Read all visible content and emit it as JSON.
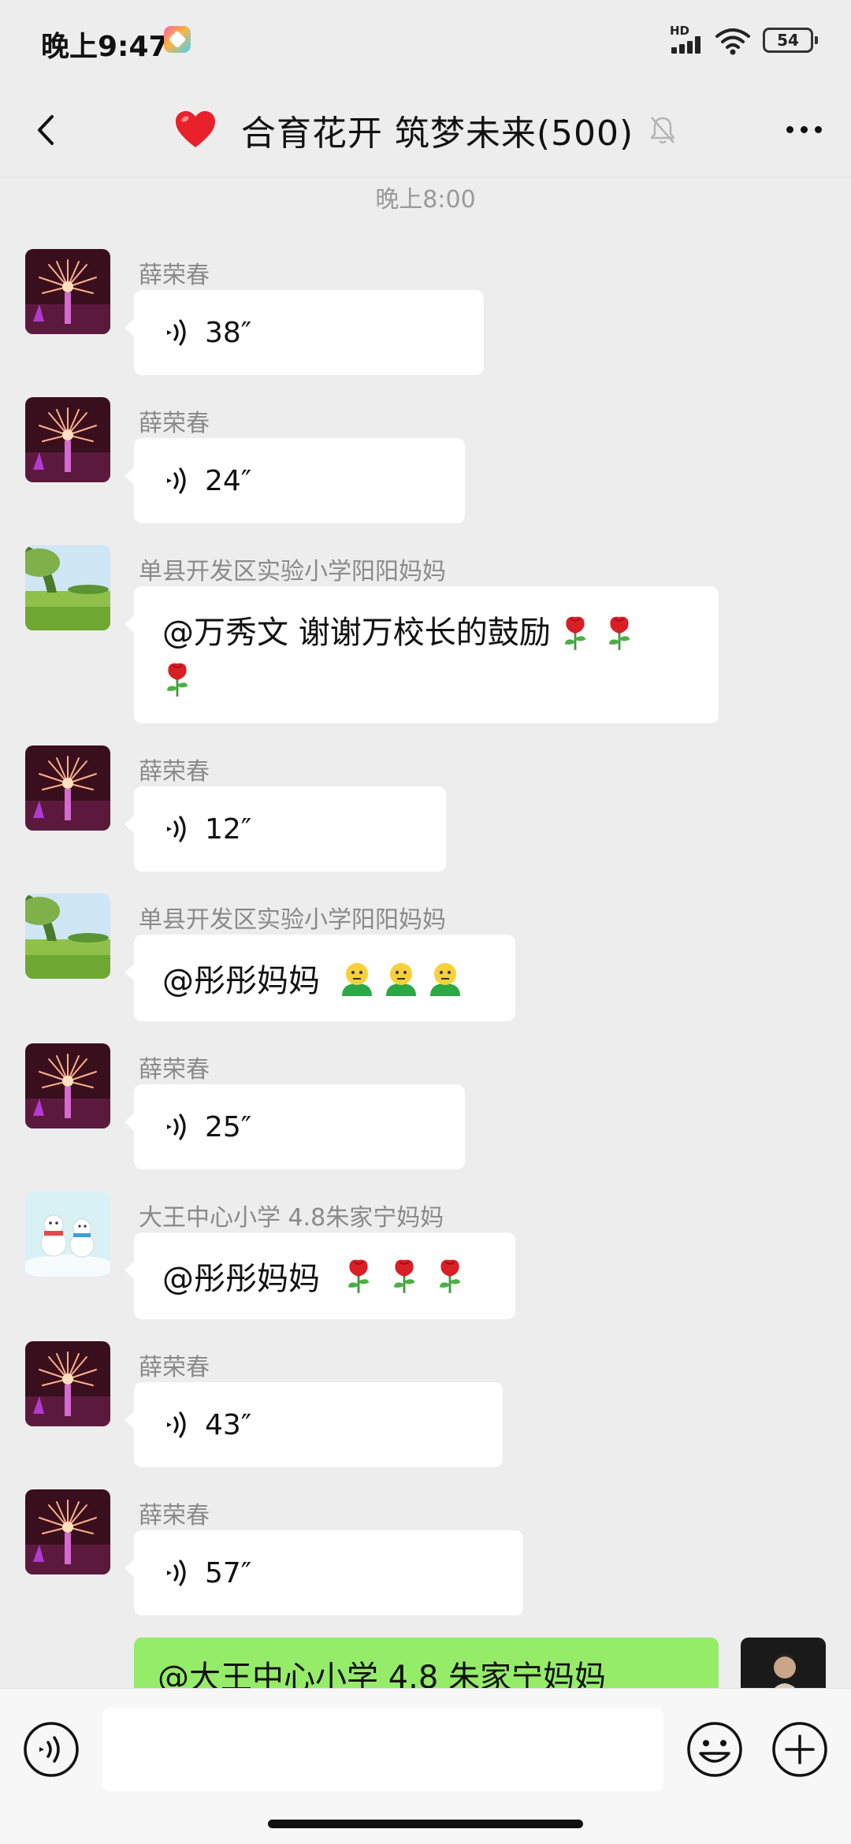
{
  "status_bar": {
    "time": "晚上9:47",
    "network_label": "HD",
    "battery": "54",
    "icons": [
      "app-badge-icon",
      "signal-icon",
      "wifi-icon",
      "battery-icon"
    ]
  },
  "header": {
    "title": "合育花开 筑梦未来(500)",
    "title_emoji": "heart",
    "icons": [
      "back-icon",
      "heart-icon",
      "mute-bell-icon",
      "more-icon"
    ]
  },
  "chat": {
    "timestamp": "晚上8:00",
    "messages": [
      {
        "sender": "薛荣春",
        "type": "voice",
        "duration": "38″",
        "avatar": "fireworks"
      },
      {
        "sender": "薛荣春",
        "type": "voice",
        "duration": "24″",
        "avatar": "fireworks"
      },
      {
        "sender": "单县开发区实验小学阳阳妈妈",
        "type": "text",
        "text_line1": "@万秀文  谢谢万校长的鼓励",
        "emoji": "rose",
        "avatar": "meadow"
      },
      {
        "sender": "薛荣春",
        "type": "voice",
        "duration": "12″",
        "avatar": "fireworks"
      },
      {
        "sender": "单县开发区实验小学阳阳妈妈",
        "type": "text",
        "text": "@彤彤妈妈",
        "emoji": "smiley-person",
        "avatar": "meadow"
      },
      {
        "sender": "薛荣春",
        "type": "voice",
        "duration": "25″",
        "avatar": "fireworks"
      },
      {
        "sender": "大王中心小学 4.8朱家宁妈妈",
        "type": "text",
        "text": "@彤彤妈妈",
        "emoji": "rose",
        "avatar": "snowmen"
      },
      {
        "sender": "薛荣春",
        "type": "voice",
        "duration": "43″",
        "avatar": "fireworks"
      },
      {
        "sender": "薛荣春",
        "type": "voice",
        "duration": "57″",
        "avatar": "fireworks"
      }
    ],
    "my_message": {
      "text": "@大王中心小学 4.8 朱家宁妈妈"
    }
  },
  "input_bar": {
    "placeholder": "",
    "icons": [
      "voice-toggle-icon",
      "emoji-icon",
      "plus-icon"
    ]
  },
  "colors": {
    "background": "#ededed",
    "bubble_other": "#ffffff",
    "bubble_mine": "#95ec69",
    "sender_text": "#8a8a8a"
  }
}
